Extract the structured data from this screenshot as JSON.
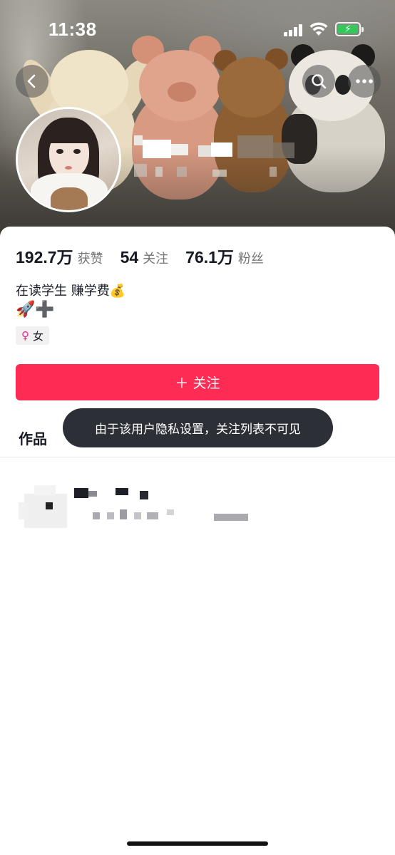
{
  "status_bar": {
    "time": "11:38"
  },
  "profile": {
    "stats": [
      {
        "value": "192.7万",
        "label": "获赞"
      },
      {
        "value": "54",
        "label": "关注"
      },
      {
        "value": "76.1万",
        "label": "粉丝"
      }
    ],
    "bio_line1": "在读学生 赚学费💰",
    "bio_line2": "🚀➕",
    "gender": {
      "symbol": "♀",
      "label": "女"
    },
    "follow_button_label": "＋ 关注"
  },
  "tabs": {
    "works_label": "作品"
  },
  "toast": {
    "message": "由于该用户隐私设置，关注列表不可见"
  },
  "colors": {
    "accent": "#fe2c55",
    "toast_bg": "#2c2f36",
    "text_primary": "#161823",
    "text_secondary": "#757575"
  },
  "icons": {
    "back": "chevron-left-icon",
    "search": "search-icon",
    "more": "more-dots-icon"
  }
}
